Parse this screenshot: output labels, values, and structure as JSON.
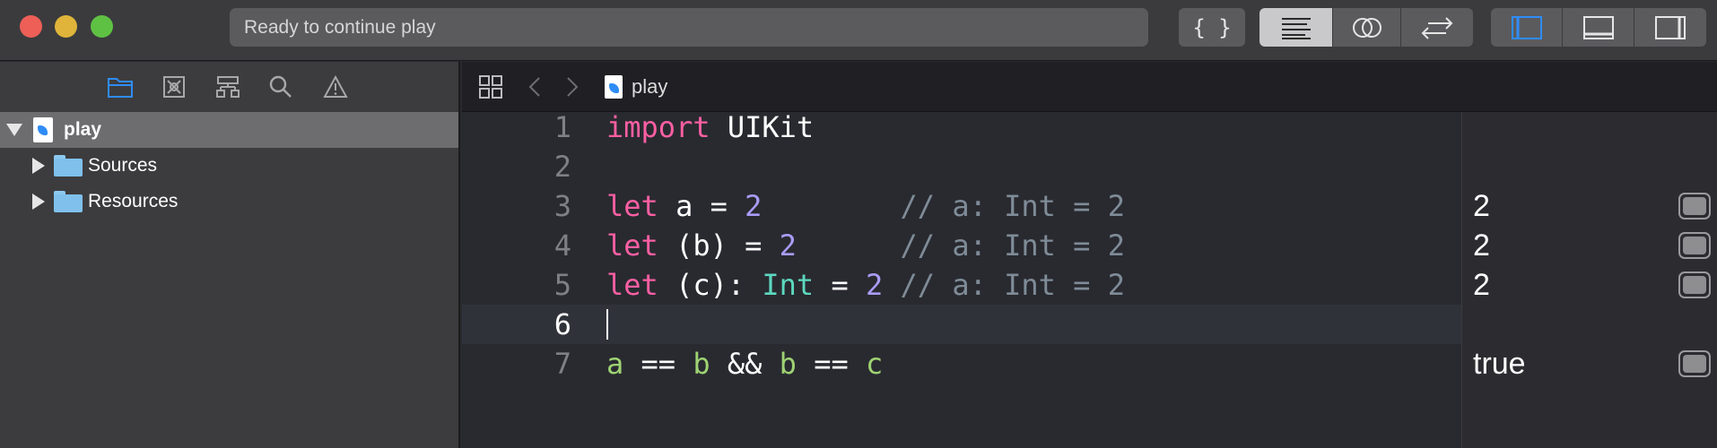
{
  "window": {
    "activity_status": "Ready to continue play"
  },
  "toolbar": {
    "icons": [
      "library-braces-icon",
      "standard-editor-icon",
      "assistant-editor-icon",
      "version-editor-icon",
      "navigator-toggle-icon",
      "debug-area-toggle-icon",
      "inspector-toggle-icon"
    ]
  },
  "navigator": {
    "tabs": [
      "project-navigator-icon",
      "source-control-icon",
      "symbol-navigator-icon",
      "find-navigator-icon",
      "issue-navigator-icon"
    ],
    "root": {
      "label": "play",
      "expanded": true
    },
    "children": [
      {
        "label": "Sources",
        "expanded": false
      },
      {
        "label": "Resources",
        "expanded": false
      }
    ],
    "accent_color": "#2f8cf6"
  },
  "jumpbar": {
    "title": "play"
  },
  "code": {
    "lines": [
      {
        "number": "1",
        "tokens": [
          [
            "kw",
            "import"
          ],
          [
            "plain",
            " UIKit"
          ]
        ]
      },
      {
        "number": "2",
        "tokens": []
      },
      {
        "number": "3",
        "tokens": [
          [
            "kw",
            "let"
          ],
          [
            "plain",
            " a = "
          ],
          [
            "num",
            "2"
          ],
          [
            "plain",
            "        "
          ],
          [
            "cmt",
            "// a: Int = 2"
          ]
        ]
      },
      {
        "number": "4",
        "tokens": [
          [
            "kw",
            "let"
          ],
          [
            "plain",
            " (b) = "
          ],
          [
            "num",
            "2"
          ],
          [
            "plain",
            "      "
          ],
          [
            "cmt",
            "// a: Int = 2"
          ]
        ]
      },
      {
        "number": "5",
        "tokens": [
          [
            "kw",
            "let"
          ],
          [
            "plain",
            " (c): "
          ],
          [
            "type",
            "Int"
          ],
          [
            "plain",
            " = "
          ],
          [
            "num",
            "2"
          ],
          [
            "plain",
            " "
          ],
          [
            "cmt",
            "// a: Int = 2"
          ]
        ]
      },
      {
        "number": "6",
        "tokens": [],
        "current": true
      },
      {
        "number": "7",
        "tokens": [
          [
            "var",
            "a"
          ],
          [
            "plain",
            " == "
          ],
          [
            "var",
            "b"
          ],
          [
            "plain",
            " && "
          ],
          [
            "var",
            "b"
          ],
          [
            "plain",
            " == "
          ],
          [
            "var",
            "c"
          ]
        ]
      }
    ]
  },
  "results": {
    "values": [
      "",
      "",
      "2",
      "2",
      "2",
      "",
      "true"
    ]
  }
}
